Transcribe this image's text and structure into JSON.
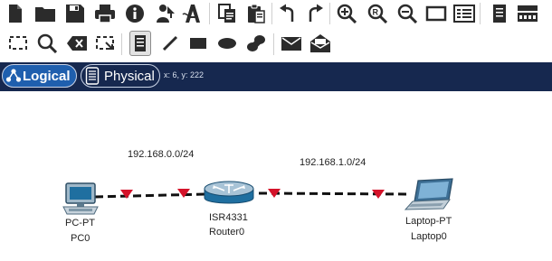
{
  "toolbar_top": {
    "icons": [
      "new-file-icon",
      "open-folder-icon",
      "save-icon",
      "print-icon",
      "info-icon",
      "activity-wizard-icon",
      "python-ide-icon",
      "copy-icon",
      "paste-icon",
      "undo-icon",
      "redo-icon",
      "zoom-in-icon",
      "zoom-reset-icon",
      "zoom-out-icon",
      "drawing-palette-icon",
      "custom-devices-icon",
      "notes-icon",
      "device-template-icon"
    ]
  },
  "toolbar_bottom": {
    "icons": [
      "select-icon",
      "inspect-icon",
      "delete-icon",
      "resize-icon",
      "place-note-icon",
      "draw-line-icon",
      "draw-rectangle-icon",
      "draw-ellipse-icon",
      "freeform-icon",
      "add-simple-pdu-icon",
      "add-complex-pdu-icon"
    ]
  },
  "modebar": {
    "logical_label": "Logical",
    "physical_label": "Physical",
    "coords": "x: 6, y: 222"
  },
  "topology": {
    "networks": [
      "192.168.0.0/24",
      "192.168.1.0/24"
    ],
    "devices": [
      {
        "model": "PC-PT",
        "name": "PC0"
      },
      {
        "model": "ISR4331",
        "name": "Router0"
      },
      {
        "model": "Laptop-PT",
        "name": "Laptop0"
      }
    ],
    "link_color": "#111111",
    "link_indicator_color": "#d4132a"
  }
}
